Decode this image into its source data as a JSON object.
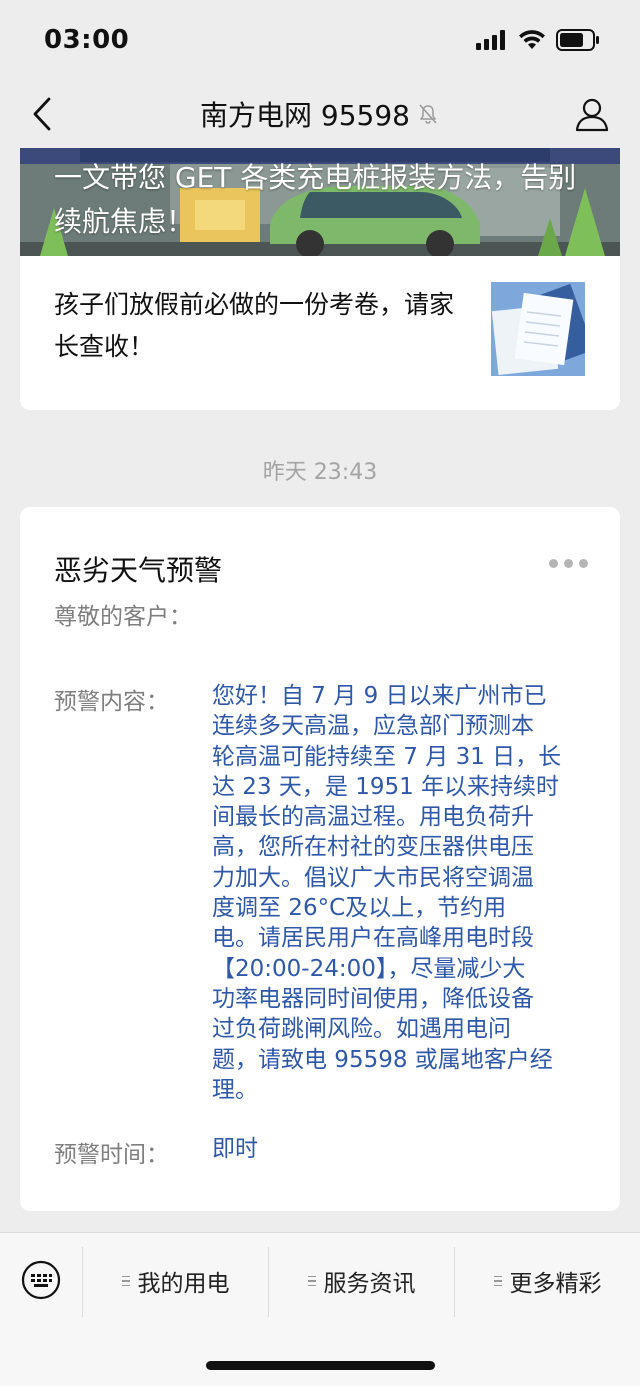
{
  "status_bar": {
    "time": "03:00"
  },
  "nav": {
    "title": "南方电网 95598"
  },
  "article": {
    "banner_title": "一文带您 GET 各类充电桩报装方法，告别续航焦虑！",
    "item_title": "孩子们放假前必做的一份考卷，请家长查收！"
  },
  "timestamp": "昨天 23:43",
  "alert": {
    "title": "恶劣天气预警",
    "greeting": "尊敬的客户：",
    "content_label": "预警内容：",
    "content_lines": [
      "您好！自 7 月 9 日以来广州市已",
      "连续多天高温，应急部门预测本",
      "轮高温可能持续至 7 月 31 日，长",
      "达 23 天，是 1951 年以来持续时",
      "间最长的高温过程。用电负荷升",
      "高，您所在村社的变压器供电压",
      "力加大。倡议广大市民将空调温",
      "度调至 26°C及以上，节约用",
      "电。请居民用户在高峰用电时段",
      "【20:00-24:00】，尽量减少大",
      "功率电器同时间使用，降低设备",
      "过负荷跳闸风险。如遇用电问",
      "题，请致电 95598 或属地客户经",
      "理。"
    ],
    "time_label": "预警时间：",
    "time_value": "即时",
    "accent_color": "#2f58a8"
  },
  "menu": {
    "items": [
      {
        "label": "我的用电"
      },
      {
        "label": "服务资讯"
      },
      {
        "label": "更多精彩"
      }
    ]
  }
}
